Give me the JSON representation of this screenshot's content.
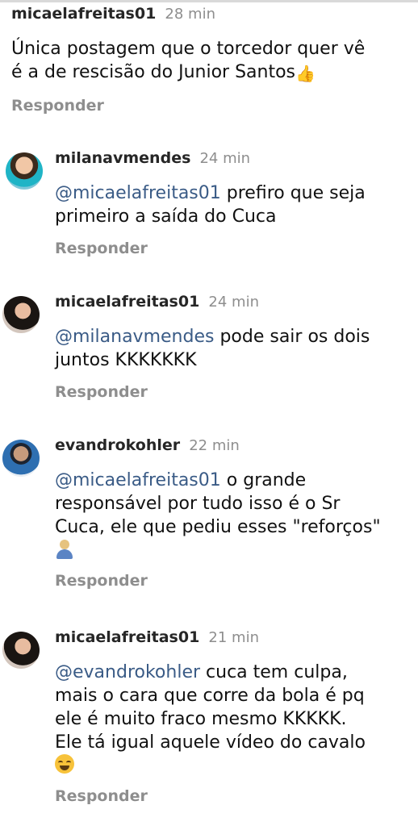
{
  "comments": [
    {
      "username": "micaelafreitas01",
      "time": "28 min",
      "mention": "",
      "text_lines": [
        "Única postagem que o torcedor quer vê",
        "é a de rescisão do Junior Santos"
      ],
      "emoji": "thumbs-up",
      "reply_label": "Responder"
    },
    {
      "username": "milanavmendes",
      "time": "24 min",
      "mention": "@micaelafreitas01",
      "line1_rest": " prefiro que seja",
      "text_lines": [
        "primeiro a saída do Cuca"
      ],
      "reply_label": "Responder"
    },
    {
      "username": "micaelafreitas01",
      "time": "24 min",
      "mention": "@milanavmendes",
      "line1_rest": " pode sair os dois",
      "text_lines": [
        "juntos KKKKKKK"
      ],
      "reply_label": "Responder"
    },
    {
      "username": "evandrokohler",
      "time": "22 min",
      "mention": "@micaelafreitas01",
      "line1_rest": " o grande",
      "text_lines": [
        "responsável por tudo isso é o Sr",
        "Cuca, ele que pediu esses \"reforços\""
      ],
      "emoji": "person-shrugging",
      "reply_label": "Responder"
    },
    {
      "username": "micaelafreitas01",
      "time": "21 min",
      "mention": "@evandrokohler",
      "line1_rest": " cuca tem culpa,",
      "text_lines": [
        "mais o cara que corre da bola é pq",
        "ele é muito fraco mesmo KKKKK.",
        "Ele tá igual aquele vídeo do cavalo"
      ],
      "emoji": "face-with-tears-of-joy",
      "reply_label": "Responder"
    }
  ]
}
